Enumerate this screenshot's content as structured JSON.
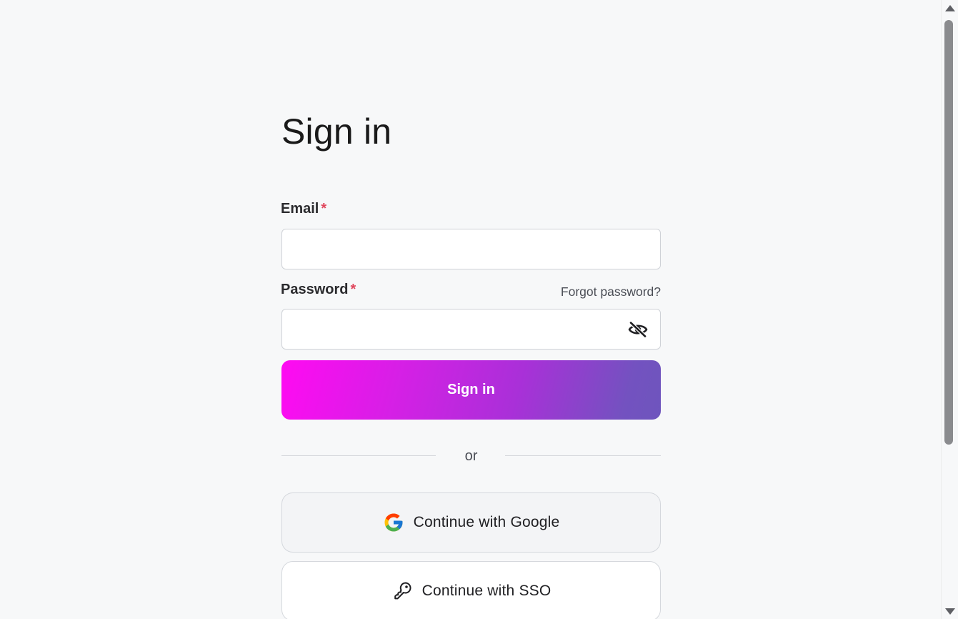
{
  "page": {
    "title": "Sign in"
  },
  "form": {
    "email": {
      "label": "Email",
      "required_mark": "*",
      "value": "",
      "placeholder": ""
    },
    "password": {
      "label": "Password",
      "required_mark": "*",
      "value": "",
      "placeholder": "",
      "forgot_label": "Forgot password?",
      "toggle_icon": "eye-off-icon"
    },
    "submit_label": "Sign in",
    "divider_text": "or"
  },
  "oauth": {
    "google": {
      "label": "Continue with Google",
      "icon": "google-icon"
    },
    "sso": {
      "label": "Continue with SSO",
      "icon": "key-icon"
    }
  },
  "colors": {
    "background": "#f7f8f9",
    "gradient_start": "#ff0af2",
    "gradient_end": "#6e55bd",
    "required": "#e0475d"
  }
}
